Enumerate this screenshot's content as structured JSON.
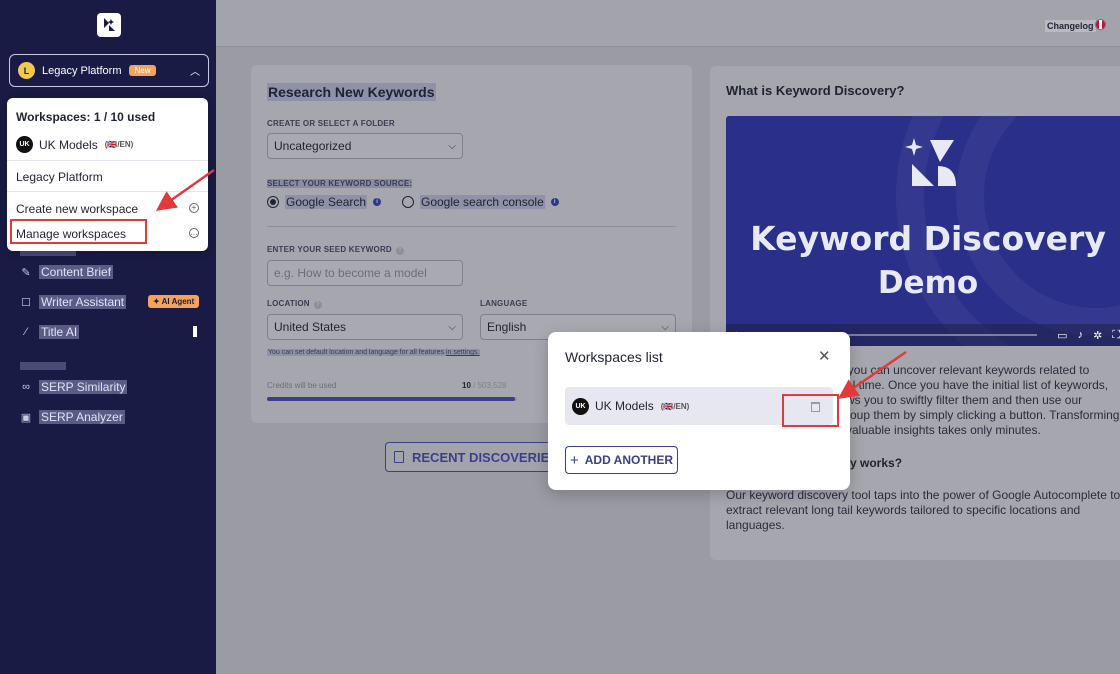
{
  "sidebar": {
    "workspace_initial": "L",
    "workspace_name": "Legacy Platform",
    "new_badge": "New",
    "items": [
      {
        "label": "Content Brief",
        "icon": "brief-icon"
      },
      {
        "label": "Writer Assistant",
        "icon": "writer-icon"
      },
      {
        "label": "Title AI",
        "icon": "magic-wand-icon"
      },
      {
        "label": "SERP Similarity",
        "icon": "overlap-icon"
      },
      {
        "label": "SERP Analyzer",
        "icon": "analyzer-icon"
      }
    ],
    "ai_agent_badge": "AI Agent"
  },
  "dropdown": {
    "heading": "Workspaces: 1 / 10 used",
    "workspace": {
      "avatar": "UK",
      "name": "UK Models",
      "tag": "(🇬🇧/EN)"
    },
    "legacy": "Legacy Platform",
    "create": "Create new workspace",
    "manage": "Manage workspaces"
  },
  "topbar": {
    "changelog": "Changelog"
  },
  "research": {
    "title": "Research New Keywords",
    "folder_label": "CREATE OR SELECT A FOLDER",
    "folder_value": "Uncategorized",
    "source_label": "SELECT YOUR KEYWORD SOURCE:",
    "source_google": "Google Search",
    "source_console": "Google search console",
    "seed_label": "ENTER YOUR SEED KEYWORD",
    "seed_placeholder": "e.g. How to become a model",
    "location_label": "LOCATION",
    "location_value": "United States",
    "language_label": "LANGUAGE",
    "language_value": "English",
    "note_pre": "You can set default location and language for all features ",
    "note_link": "in settings.",
    "credits_label": "Credits will be used",
    "credits_used": "10",
    "credits_total": " / 503,528",
    "credits_fraction": 0.99
  },
  "recent_button": "RECENT DISCOVERIES",
  "right": {
    "title": "What is Keyword Discovery?",
    "video_line1": "Keyword Discovery",
    "video_line2": "Demo",
    "para1_lines": [
      "y, you can uncover relevant keywords related to",
      "al time. Once you have the initial list of keywords,",
      "ws you to swiftly filter them and then use our",
      "roup them by simply clicking a button. Transforming",
      "valuable insights takes only minutes."
    ],
    "sub": "y works?",
    "para2": "Our keyword discovery tool taps into the power of Google Autocomplete to extract relevant long tail keywords tailored to specific locations and languages."
  },
  "modal": {
    "title": "Workspaces list",
    "ws_avatar": "UK",
    "ws_name": "UK Models",
    "ws_tag": "(🇬🇧/EN)",
    "add_label": "ADD ANOTHER"
  },
  "colors": {
    "sidebar": "#1a1b45",
    "accent": "#3b3f8a",
    "highlight_red": "#e03a3a",
    "badge_orange": "#f5a35c"
  }
}
